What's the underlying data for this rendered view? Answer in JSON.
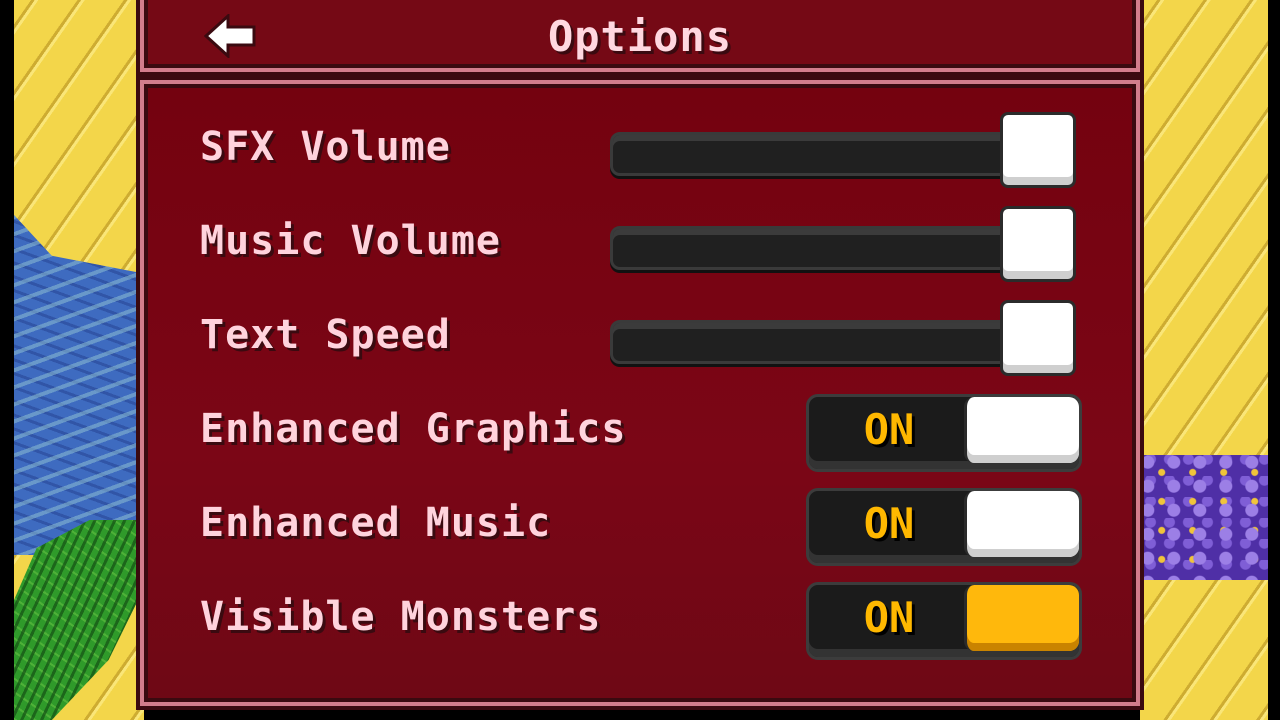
{
  "header": {
    "title": "Options",
    "back_icon": "left-arrow-icon"
  },
  "options": [
    {
      "label": "SFX Volume",
      "type": "slider",
      "level": 1.0
    },
    {
      "label": "Music Volume",
      "type": "slider",
      "level": 1.0
    },
    {
      "label": "Text Speed",
      "type": "slider",
      "level": 1.0
    },
    {
      "label": "Enhanced Graphics",
      "type": "toggle",
      "state": "ON",
      "knob_color": "#ffffff"
    },
    {
      "label": "Enhanced Music",
      "type": "toggle",
      "state": "ON",
      "knob_color": "#ffffff"
    },
    {
      "label": "Visible Monsters",
      "type": "toggle",
      "state": "ON",
      "knob_color": "#ffb80c",
      "selected": true
    }
  ],
  "colors": {
    "panel": "#740210",
    "frame_border": "#d27d8c",
    "label_text": "#ffd3dd",
    "toggle_text": "#ffb800",
    "highlight": "#ffb80c"
  }
}
